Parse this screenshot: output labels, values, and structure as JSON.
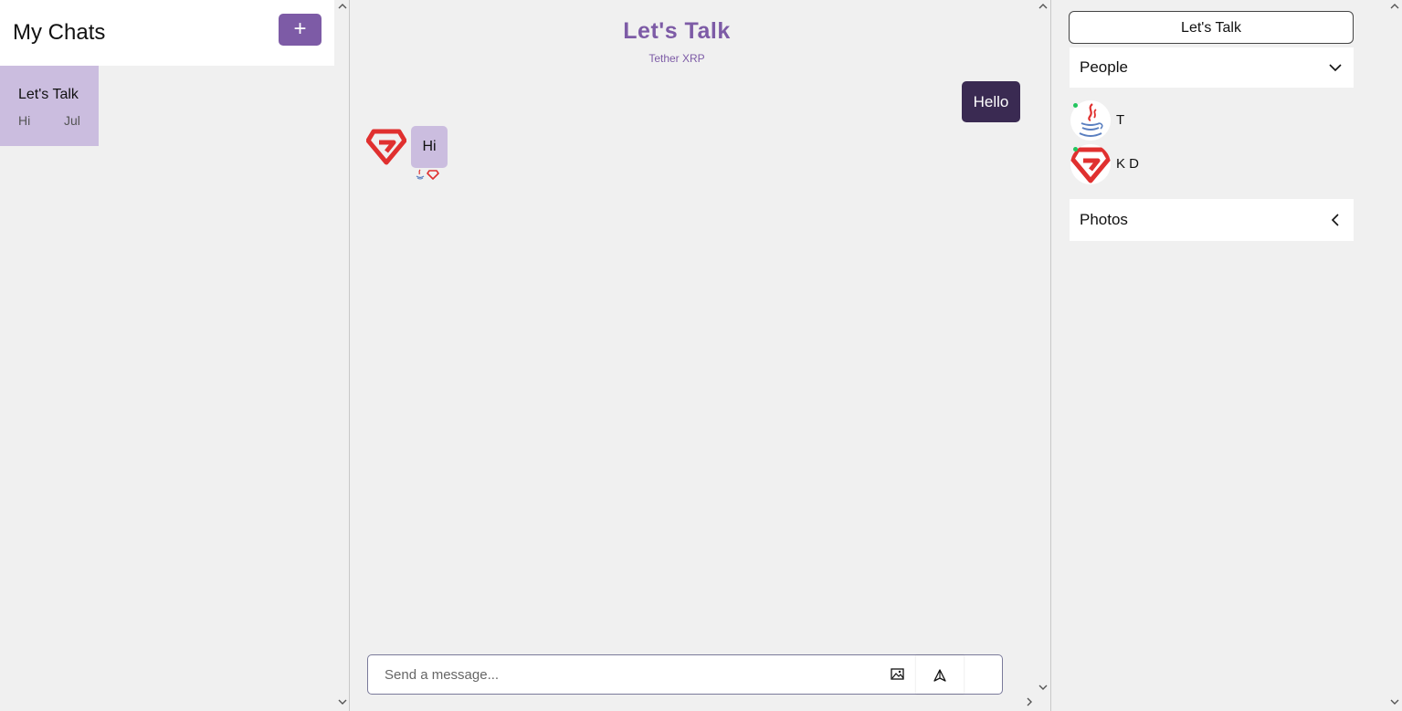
{
  "left": {
    "title": "My Chats",
    "new_chat_label": "+",
    "chats": [
      {
        "name": "Let's Talk",
        "last_message": "Hi",
        "date": "Jul"
      }
    ]
  },
  "center": {
    "title": "Let's Talk",
    "subtitle": "Tether XRP",
    "messages": [
      {
        "direction": "outgoing",
        "text": "Hello"
      },
      {
        "direction": "incoming",
        "text": "Hi",
        "avatar": "ruby-logo-icon"
      }
    ],
    "composer": {
      "placeholder": "Send a message...",
      "value": ""
    }
  },
  "right": {
    "title": "Let's Talk",
    "people_label": "People",
    "photos_label": "Photos",
    "people": [
      {
        "name": "T",
        "avatar": "java-logo-icon",
        "online": true
      },
      {
        "name": "K D",
        "avatar": "ruby-logo-icon",
        "online": true
      }
    ]
  },
  "colors": {
    "accent": "#7d5ba6",
    "outgoing_bubble": "#3a2a52",
    "incoming_bubble": "#cbbddf",
    "online": "#22c55e",
    "background": "#f0f0f0"
  }
}
